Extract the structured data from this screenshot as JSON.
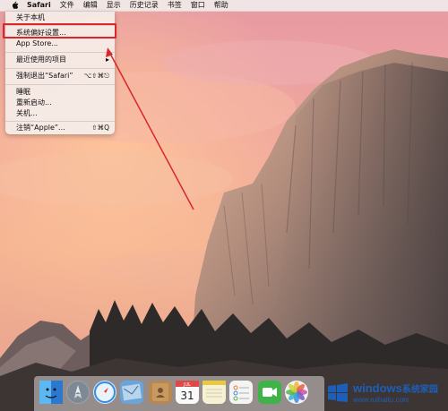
{
  "menubar": {
    "items": [
      "Safari",
      "文件",
      "编辑",
      "显示",
      "历史记录",
      "书签",
      "窗口",
      "帮助"
    ]
  },
  "apple_menu": {
    "items": [
      {
        "label": "关于本机",
        "shortcut": ""
      },
      {
        "label": "系统偏好设置...",
        "shortcut": ""
      },
      {
        "label": "App Store...",
        "shortcut": ""
      },
      {
        "label": "最近使用的项目",
        "shortcut": ""
      },
      {
        "label": "强制退出“Safari”",
        "shortcut": "⌥⇧⌘⎋"
      },
      {
        "label": "睡眠",
        "shortcut": ""
      },
      {
        "label": "重新启动...",
        "shortcut": ""
      },
      {
        "label": "关机...",
        "shortcut": ""
      },
      {
        "label": "注销“Apple”...",
        "shortcut": "⇧⌘Q"
      }
    ],
    "highlighted_item": "系统偏好设置..."
  },
  "dock": {
    "icons": [
      "finder-icon",
      "launchpad-icon",
      "safari-icon",
      "mail-icon",
      "contacts-icon",
      "calendar-icon",
      "notes-icon",
      "reminders-icon",
      "facetime-icon",
      "photos-icon"
    ],
    "calendar_month": "JUL",
    "calendar_day": "31"
  },
  "watermark": {
    "title": "windows",
    "title_cn": "系统家园",
    "url": "www.ruihaitu.com"
  },
  "colors": {
    "annotation": "#d8282a",
    "brand": "#1d5fb8"
  }
}
